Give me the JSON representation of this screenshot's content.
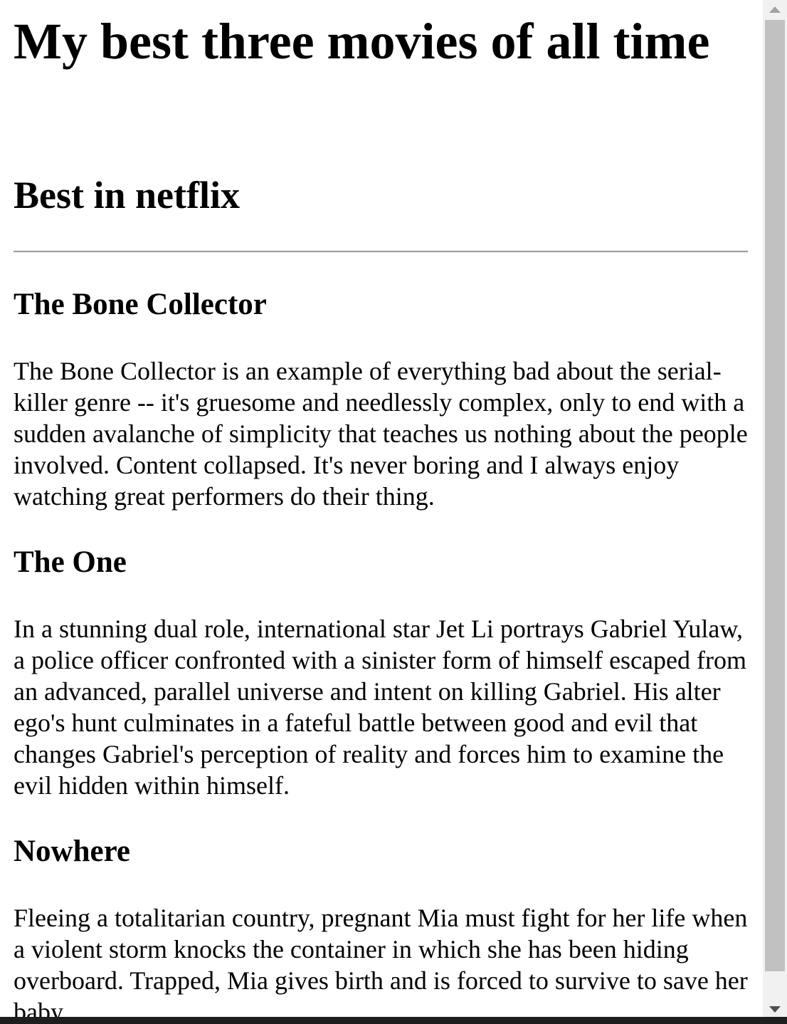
{
  "page": {
    "title": "My best three movies of all time",
    "subtitle": "Best in netflix"
  },
  "movies": [
    {
      "title": "The Bone Collector",
      "description": "The Bone Collector is an example of everything bad about the serial-killer genre -- it's gruesome and needlessly complex, only to end with a sudden avalanche of simplicity that teaches us nothing about the people involved. Content collapsed. It's never boring and I always enjoy watching great performers do their thing."
    },
    {
      "title": "The One",
      "description": "In a stunning dual role, international star Jet Li portrays Gabriel Yulaw, a police officer confronted with a sinister form of himself escaped from an advanced, parallel universe and intent on killing Gabriel. His alter ego's hunt culminates in a fateful battle between good and evil that changes Gabriel's perception of reality and forces him to examine the evil hidden within himself."
    },
    {
      "title": "Nowhere",
      "description": "Fleeing a totalitarian country, pregnant Mia must fight for her life when a violent storm knocks the container in which she has been hiding overboard. Trapped, Mia gives birth and is forced to survive to save her baby."
    }
  ],
  "icons": {
    "scroll_up": "scroll-up-arrow-icon",
    "scroll_down": "scroll-down-arrow-icon"
  },
  "colors": {
    "text": "#000000",
    "background": "#ffffff",
    "divider": "#a0a0a0",
    "scrollbar_track": "#f1f1f1",
    "scrollbar_thumb": "#c1c1c1"
  }
}
